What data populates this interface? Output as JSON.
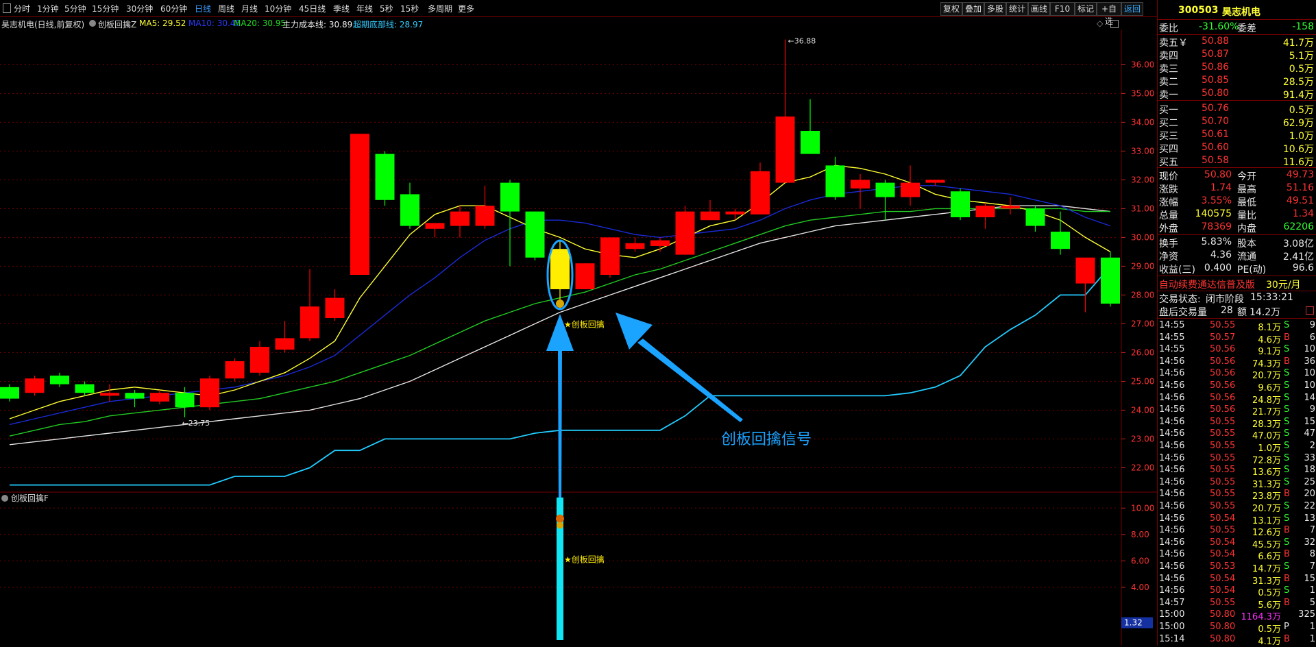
{
  "toolbar": {
    "items": [
      "分时",
      "1分钟",
      "5分钟",
      "15分钟",
      "30分钟",
      "60分钟",
      "日线",
      "周线",
      "月线",
      "10分钟",
      "45日线",
      "季线",
      "年线",
      "5秒",
      "15秒",
      "多周期",
      "更多"
    ],
    "active": "日线",
    "right_items": [
      "复权",
      "叠加",
      "多股",
      "统计",
      "画线",
      "F10",
      "标记",
      "+自选",
      "返回"
    ]
  },
  "title": {
    "stock": "昊志机电(日线,前复权)",
    "indicator": "创板回擒Z",
    "ma5": "MA5: 29.52",
    "ma10": "MA10: 30.45",
    "ma20": "MA20: 30.95",
    "cost": "主力成本线: 30.89",
    "bottom": "超期底部线: 28.97"
  },
  "main_chart": {
    "ylim": [
      21.2,
      37.2
    ],
    "y_ticks": [
      "36.00",
      "35.00",
      "34.00",
      "33.00",
      "32.00",
      "31.00",
      "30.00",
      "29.00",
      "28.00",
      "27.00",
      "26.00",
      "25.00",
      "24.00",
      "23.00",
      "22.00"
    ],
    "high_label": "36.88",
    "low_label": "23.75",
    "signal_label": "★创板回擒",
    "annotation": "创板回擒信号"
  },
  "chart_data": {
    "type": "candlestick",
    "candles": [
      {
        "o": 24.8,
        "c": 24.4,
        "h": 24.9,
        "l": 24.3
      },
      {
        "o": 24.6,
        "c": 25.1,
        "h": 25.2,
        "l": 24.5
      },
      {
        "o": 25.2,
        "c": 24.9,
        "h": 25.3,
        "l": 24.8
      },
      {
        "o": 24.9,
        "c": 24.6,
        "h": 25.0,
        "l": 24.5
      },
      {
        "o": 24.5,
        "c": 24.6,
        "h": 24.9,
        "l": 24.3
      },
      {
        "o": 24.6,
        "c": 24.4,
        "h": 24.7,
        "l": 24.1
      },
      {
        "o": 24.3,
        "c": 24.6,
        "h": 24.7,
        "l": 24.2
      },
      {
        "o": 24.6,
        "c": 24.1,
        "h": 24.8,
        "l": 23.75
      },
      {
        "o": 24.1,
        "c": 25.1,
        "h": 25.2,
        "l": 24.0
      },
      {
        "o": 25.1,
        "c": 25.7,
        "h": 25.8,
        "l": 25.0
      },
      {
        "o": 25.3,
        "c": 26.2,
        "h": 26.4,
        "l": 25.2
      },
      {
        "o": 26.1,
        "c": 26.5,
        "h": 27.1,
        "l": 26.0
      },
      {
        "o": 26.5,
        "c": 27.6,
        "h": 28.9,
        "l": 26.4
      },
      {
        "o": 27.2,
        "c": 27.9,
        "h": 28.2,
        "l": 27.1
      },
      {
        "o": 28.7,
        "c": 33.6,
        "h": 33.6,
        "l": 28.7
      },
      {
        "o": 32.9,
        "c": 31.3,
        "h": 33.0,
        "l": 31.1
      },
      {
        "o": 31.5,
        "c": 30.4,
        "h": 31.9,
        "l": 30.3
      },
      {
        "o": 30.3,
        "c": 30.5,
        "h": 30.5,
        "l": 30.0
      },
      {
        "o": 30.4,
        "c": 30.9,
        "h": 31.1,
        "l": 30.0
      },
      {
        "o": 30.4,
        "c": 31.1,
        "h": 31.8,
        "l": 30.3
      },
      {
        "o": 31.9,
        "c": 30.9,
        "h": 32.0,
        "l": 29.0
      },
      {
        "o": 30.9,
        "c": 29.3,
        "h": 30.9,
        "l": 29.2
      },
      {
        "o": 29.6,
        "c": 28.2,
        "h": 29.9,
        "l": 27.5
      },
      {
        "o": 28.2,
        "c": 29.1,
        "h": 29.1,
        "l": 28.2
      },
      {
        "o": 28.7,
        "c": 30.0,
        "h": 30.0,
        "l": 28.6
      },
      {
        "o": 29.6,
        "c": 29.8,
        "h": 30.0,
        "l": 29.5
      },
      {
        "o": 29.7,
        "c": 29.9,
        "h": 30.0,
        "l": 29.5
      },
      {
        "o": 29.4,
        "c": 30.9,
        "h": 31.1,
        "l": 29.4
      },
      {
        "o": 30.6,
        "c": 30.9,
        "h": 31.3,
        "l": 30.6
      },
      {
        "o": 30.8,
        "c": 30.9,
        "h": 31.0,
        "l": 30.6
      },
      {
        "o": 30.8,
        "c": 32.3,
        "h": 32.6,
        "l": 30.8
      },
      {
        "o": 31.9,
        "c": 34.2,
        "h": 36.88,
        "l": 31.9
      },
      {
        "o": 33.7,
        "c": 32.9,
        "h": 34.8,
        "l": 32.9
      },
      {
        "o": 32.5,
        "c": 31.4,
        "h": 32.8,
        "l": 31.3
      },
      {
        "o": 31.7,
        "c": 32.0,
        "h": 32.2,
        "l": 31.0
      },
      {
        "o": 31.9,
        "c": 31.4,
        "h": 32.0,
        "l": 30.6
      },
      {
        "o": 31.4,
        "c": 31.9,
        "h": 32.5,
        "l": 31.1
      },
      {
        "o": 31.9,
        "c": 32.0,
        "h": 32.0,
        "l": 31.8
      },
      {
        "o": 31.6,
        "c": 30.7,
        "h": 31.7,
        "l": 30.6
      },
      {
        "o": 30.7,
        "c": 31.1,
        "h": 31.2,
        "l": 30.3
      },
      {
        "o": 31.0,
        "c": 31.1,
        "h": 31.4,
        "l": 30.8
      },
      {
        "o": 31.0,
        "c": 30.4,
        "h": 31.1,
        "l": 30.2
      },
      {
        "o": 30.2,
        "c": 29.6,
        "h": 30.9,
        "l": 29.4
      },
      {
        "o": 28.4,
        "c": 29.3,
        "h": 29.3,
        "l": 27.4
      },
      {
        "o": 29.3,
        "c": 27.7,
        "h": 29.5,
        "l": 27.6
      }
    ],
    "ma5": [
      23.7,
      24.0,
      24.3,
      24.5,
      24.7,
      24.8,
      24.7,
      24.6,
      24.5,
      24.7,
      25.0,
      25.3,
      25.8,
      26.4,
      27.9,
      29.0,
      30.1,
      30.8,
      31.1,
      31.1,
      30.7,
      30.3,
      30.0,
      29.6,
      29.4,
      29.3,
      29.6,
      30.0,
      30.4,
      30.6,
      31.2,
      31.9,
      32.1,
      32.5,
      32.4,
      32.2,
      31.9,
      31.5,
      31.3,
      31.2,
      31.1,
      30.9,
      30.6,
      30.0,
      29.5
    ],
    "ma10": [
      23.5,
      23.7,
      23.9,
      24.1,
      24.3,
      24.4,
      24.5,
      24.6,
      24.7,
      24.8,
      25.0,
      25.2,
      25.5,
      25.9,
      26.6,
      27.3,
      28.0,
      28.6,
      29.3,
      29.9,
      30.3,
      30.6,
      30.6,
      30.5,
      30.3,
      30.1,
      30.0,
      30.1,
      30.2,
      30.3,
      30.6,
      31.0,
      31.3,
      31.5,
      31.6,
      31.7,
      31.8,
      31.8,
      31.7,
      31.6,
      31.5,
      31.3,
      31.1,
      30.7,
      30.4
    ],
    "ma20": [
      23.1,
      23.3,
      23.5,
      23.6,
      23.8,
      23.9,
      24.0,
      24.1,
      24.2,
      24.3,
      24.4,
      24.6,
      24.8,
      25.0,
      25.3,
      25.6,
      25.9,
      26.3,
      26.7,
      27.1,
      27.4,
      27.7,
      27.9,
      28.1,
      28.4,
      28.7,
      28.9,
      29.2,
      29.5,
      29.8,
      30.1,
      30.4,
      30.6,
      30.7,
      30.8,
      30.9,
      30.9,
      31.0,
      31.0,
      31.0,
      31.0,
      31.0,
      31.0,
      30.9,
      30.9
    ],
    "cost": [
      22.8,
      22.9,
      23.0,
      23.1,
      23.2,
      23.3,
      23.4,
      23.5,
      23.6,
      23.7,
      23.8,
      23.9,
      24.0,
      24.2,
      24.4,
      24.7,
      25.0,
      25.4,
      25.8,
      26.2,
      26.6,
      27.0,
      27.4,
      27.7,
      28.0,
      28.3,
      28.6,
      28.9,
      29.2,
      29.5,
      29.8,
      30.0,
      30.2,
      30.4,
      30.5,
      30.6,
      30.7,
      30.8,
      30.9,
      31.0,
      31.1,
      31.1,
      31.1,
      31.0,
      30.9
    ],
    "bottom": [
      21.4,
      21.4,
      21.4,
      21.4,
      21.4,
      21.4,
      21.4,
      21.4,
      21.4,
      21.7,
      21.7,
      21.7,
      22.0,
      22.6,
      22.6,
      23.0,
      23.0,
      23.0,
      23.0,
      23.0,
      23.0,
      23.2,
      23.3,
      23.3,
      23.3,
      23.3,
      23.3,
      23.8,
      24.5,
      24.5,
      24.5,
      24.5,
      24.5,
      24.5,
      24.5,
      24.5,
      24.6,
      24.8,
      25.2,
      26.2,
      26.8,
      27.3,
      28.0,
      28.0,
      29.0
    ],
    "signal_index": 22
  },
  "sub_chart": {
    "label": "创板回擒F",
    "y_ticks": [
      "10.00",
      "8.00",
      "6.00",
      "4.00"
    ],
    "ylim": [
      0,
      11
    ],
    "signal_label": "★创板回擒",
    "current_value": "1.32"
  },
  "panel": {
    "code": "300503",
    "name": "昊志机电",
    "weibi_label": "委比",
    "weibi": "-31.60%",
    "weicha_label": "委差",
    "weicha": "-158",
    "asks": [
      {
        "label": "卖五￥",
        "price": "50.88",
        "vol": "41.7万"
      },
      {
        "label": "卖四",
        "price": "50.87",
        "vol": "5.1万"
      },
      {
        "label": "卖三",
        "price": "50.86",
        "vol": "0.5万"
      },
      {
        "label": "卖二",
        "price": "50.85",
        "vol": "28.5万"
      },
      {
        "label": "卖一",
        "price": "50.80",
        "vol": "91.4万"
      }
    ],
    "bids": [
      {
        "label": "买一",
        "price": "50.76",
        "vol": "0.5万"
      },
      {
        "label": "买二",
        "price": "50.70",
        "vol": "62.9万"
      },
      {
        "label": "买三",
        "price": "50.61",
        "vol": "1.0万"
      },
      {
        "label": "买四",
        "price": "50.60",
        "vol": "10.6万"
      },
      {
        "label": "买五",
        "price": "50.58",
        "vol": "11.6万"
      }
    ],
    "quote": [
      {
        "l1": "现价",
        "v1": "50.80",
        "c1": "red",
        "l2": "今开",
        "v2": "49.73",
        "c2": "red"
      },
      {
        "l1": "涨跌",
        "v1": "1.74",
        "c1": "red",
        "l2": "最高",
        "v2": "51.16",
        "c2": "red"
      },
      {
        "l1": "涨幅",
        "v1": "3.55%",
        "c1": "red",
        "l2": "最低",
        "v2": "49.51",
        "c2": "red"
      },
      {
        "l1": "总量",
        "v1": "140575",
        "c1": "yellow",
        "l2": "量比",
        "v2": "1.34",
        "c2": "red"
      },
      {
        "l1": "外盘",
        "v1": "78369",
        "c1": "red",
        "l2": "内盘",
        "v2": "62206",
        "c2": "green"
      }
    ],
    "fund": [
      {
        "l1": "换手",
        "v1": "5.83%",
        "l2": "股本",
        "v2": "3.08亿"
      },
      {
        "l1": "净资",
        "v1": "4.36",
        "l2": "流通",
        "v2": "2.41亿"
      },
      {
        "l1": "收益(三)",
        "v1": "0.400",
        "l2": "PE(动)",
        "v2": "96.6"
      }
    ],
    "ad_text": "自动续费通达信普及版",
    "ad_price": "30元/月",
    "status_label": "交易状态:",
    "status": "闭市阶段",
    "status_time": "15:33:21",
    "after_label": "盘后交易量",
    "after_vol": "28",
    "after_amt_label": "额",
    "after_amt": "14.2万",
    "ticks": [
      {
        "t": "14:55",
        "p": "50.55",
        "v": "8.1万",
        "s": "S",
        "n": "9"
      },
      {
        "t": "14:55",
        "p": "50.57",
        "v": "4.6万",
        "s": "B",
        "n": "6"
      },
      {
        "t": "14:55",
        "p": "50.56",
        "v": "9.1万",
        "s": "S",
        "n": "10"
      },
      {
        "t": "14:56",
        "p": "50.56",
        "v": "74.3万",
        "s": "B",
        "n": "36"
      },
      {
        "t": "14:56",
        "p": "50.56",
        "v": "20.7万",
        "s": "S",
        "n": "10"
      },
      {
        "t": "14:56",
        "p": "50.56",
        "v": "9.6万",
        "s": "S",
        "n": "10"
      },
      {
        "t": "14:56",
        "p": "50.56",
        "v": "24.8万",
        "s": "S",
        "n": "14"
      },
      {
        "t": "14:56",
        "p": "50.56",
        "v": "21.7万",
        "s": "S",
        "n": "9"
      },
      {
        "t": "14:56",
        "p": "50.55",
        "v": "28.3万",
        "s": "S",
        "n": "15"
      },
      {
        "t": "14:56",
        "p": "50.55",
        "v": "47.0万",
        "s": "S",
        "n": "47"
      },
      {
        "t": "14:56",
        "p": "50.55",
        "v": "1.0万",
        "s": "S",
        "n": "2"
      },
      {
        "t": "14:56",
        "p": "50.55",
        "v": "72.8万",
        "s": "S",
        "n": "33"
      },
      {
        "t": "14:56",
        "p": "50.55",
        "v": "13.6万",
        "s": "S",
        "n": "18"
      },
      {
        "t": "14:56",
        "p": "50.55",
        "v": "31.3万",
        "s": "S",
        "n": "25"
      },
      {
        "t": "14:56",
        "p": "50.55",
        "v": "23.8万",
        "s": "B",
        "n": "20"
      },
      {
        "t": "14:56",
        "p": "50.55",
        "v": "20.7万",
        "s": "S",
        "n": "22"
      },
      {
        "t": "14:56",
        "p": "50.54",
        "v": "13.1万",
        "s": "S",
        "n": "13"
      },
      {
        "t": "14:56",
        "p": "50.55",
        "v": "12.6万",
        "s": "B",
        "n": "7"
      },
      {
        "t": "14:56",
        "p": "50.54",
        "v": "45.5万",
        "s": "S",
        "n": "32"
      },
      {
        "t": "14:56",
        "p": "50.54",
        "v": "6.6万",
        "s": "B",
        "n": "8"
      },
      {
        "t": "14:56",
        "p": "50.53",
        "v": "14.7万",
        "s": "S",
        "n": "7"
      },
      {
        "t": "14:56",
        "p": "50.54",
        "v": "31.3万",
        "s": "B",
        "n": "15"
      },
      {
        "t": "14:56",
        "p": "50.54",
        "v": "0.5万",
        "s": "S",
        "n": "1"
      },
      {
        "t": "14:57",
        "p": "50.55",
        "v": "5.6万",
        "s": "B",
        "n": "5"
      },
      {
        "t": "15:00",
        "p": "50.80",
        "v": "1164.3万",
        "s": "",
        "n": "325"
      },
      {
        "t": "15:00",
        "p": "50.80",
        "v": "0.5万",
        "s": "P",
        "n": "1"
      },
      {
        "t": "15:14",
        "p": "50.80",
        "v": "4.1万",
        "s": "B",
        "n": "1"
      }
    ]
  },
  "colors": {
    "up": "#ff0000",
    "down": "#00ff00",
    "ma5": "#ffff33",
    "ma10": "#1a2bd8",
    "ma20": "#22cc22",
    "cost": "#e6e6e6",
    "bottom": "#22ccff",
    "grid": "#7a0000",
    "annotation": "#1aa3ff",
    "signal": "#ffee00",
    "sub_bar": "#11e6f5"
  }
}
